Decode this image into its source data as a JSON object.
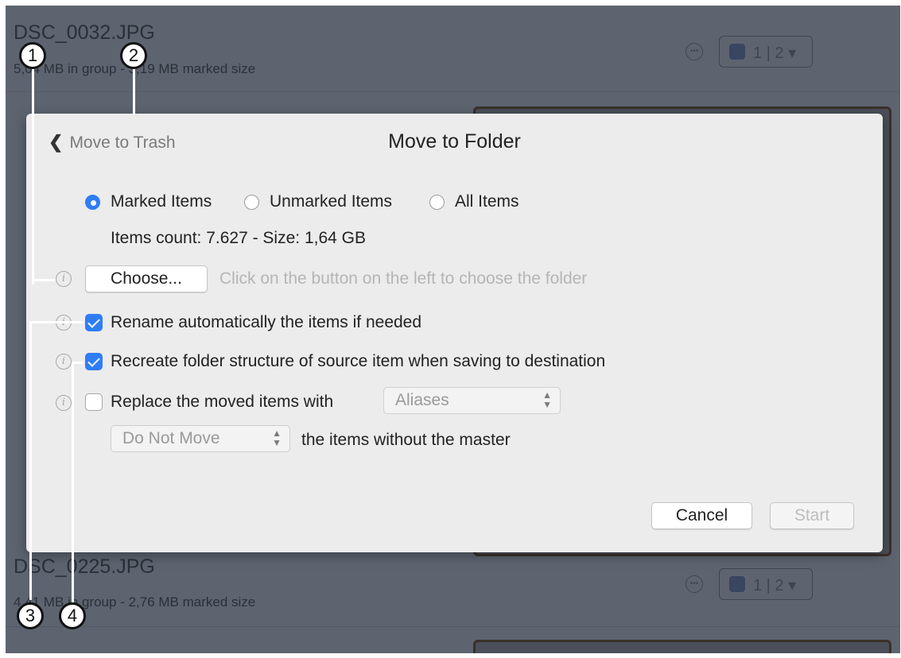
{
  "background": {
    "top_item": {
      "filename": "DSC_0032.JPG",
      "subtitle": "5,04 MB in group - 3,19 MB marked size",
      "selector_label": "1 | 2 ▾"
    },
    "bottom_item": {
      "filename": "DSC_0225.JPG",
      "subtitle": "4,41 MB in group - 2,76 MB marked size",
      "selector_label": "1 | 2 ▾"
    }
  },
  "dialog": {
    "back_label": "Move to Trash",
    "title": "Move to Folder",
    "radios": [
      {
        "label": "Marked Items",
        "selected": true
      },
      {
        "label": "Unmarked Items",
        "selected": false
      },
      {
        "label": "All Items",
        "selected": false
      }
    ],
    "items_info": "Items count: 7.627 - Size: 1,64 GB",
    "choose_button": "Choose...",
    "choose_hint": "Click on the button on the left to choose the folder",
    "options": [
      {
        "label": "Rename automatically the items if needed",
        "checked": true
      },
      {
        "label": "Recreate folder structure of source item when saving to destination",
        "checked": true
      },
      {
        "label": "Replace the moved items with",
        "checked": false
      }
    ],
    "replace_popup": "Aliases",
    "master_popup": "Do Not Move",
    "master_suffix": "the items without the master",
    "cancel_button": "Cancel",
    "start_button": "Start"
  },
  "callouts": [
    "1",
    "2",
    "3",
    "4"
  ],
  "colors": {
    "accent": "#2f7df6",
    "overlay": "#5d6470",
    "dialog_bg": "#ececec"
  },
  "icons": {
    "back": "chevron-left-icon",
    "info": "info-icon",
    "more": "more-icon"
  }
}
